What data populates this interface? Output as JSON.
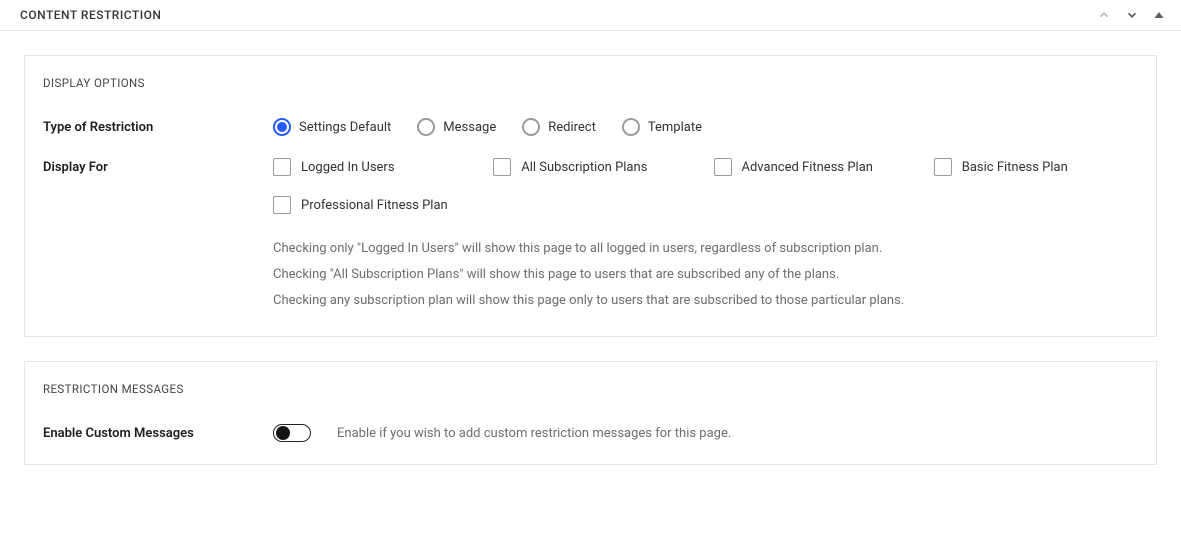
{
  "header": {
    "title": "CONTENT RESTRICTION"
  },
  "display_options": {
    "section_title": "DISPLAY OPTIONS",
    "type_label": "Type of Restriction",
    "radios": {
      "default": "Settings Default",
      "message": "Message",
      "redirect": "Redirect",
      "template": "Template"
    },
    "display_for_label": "Display For",
    "checks": {
      "logged_in": "Logged In Users",
      "all_plans": "All Subscription Plans",
      "advanced": "Advanced Fitness Plan",
      "basic": "Basic Fitness Plan",
      "professional": "Professional Fitness Plan"
    },
    "help": {
      "l1": "Checking only \"Logged In Users\" will show this page to all logged in users, regardless of subscription plan.",
      "l2": "Checking \"All Subscription Plans\" will show this page to users that are subscribed any of the plans.",
      "l3": "Checking any subscription plan will show this page only to users that are subscribed to those particular plans."
    }
  },
  "restriction_messages": {
    "section_title": "RESTRICTION MESSAGES",
    "toggle_label": "Enable Custom Messages",
    "toggle_desc": "Enable if you wish to add custom restriction messages for this page."
  }
}
